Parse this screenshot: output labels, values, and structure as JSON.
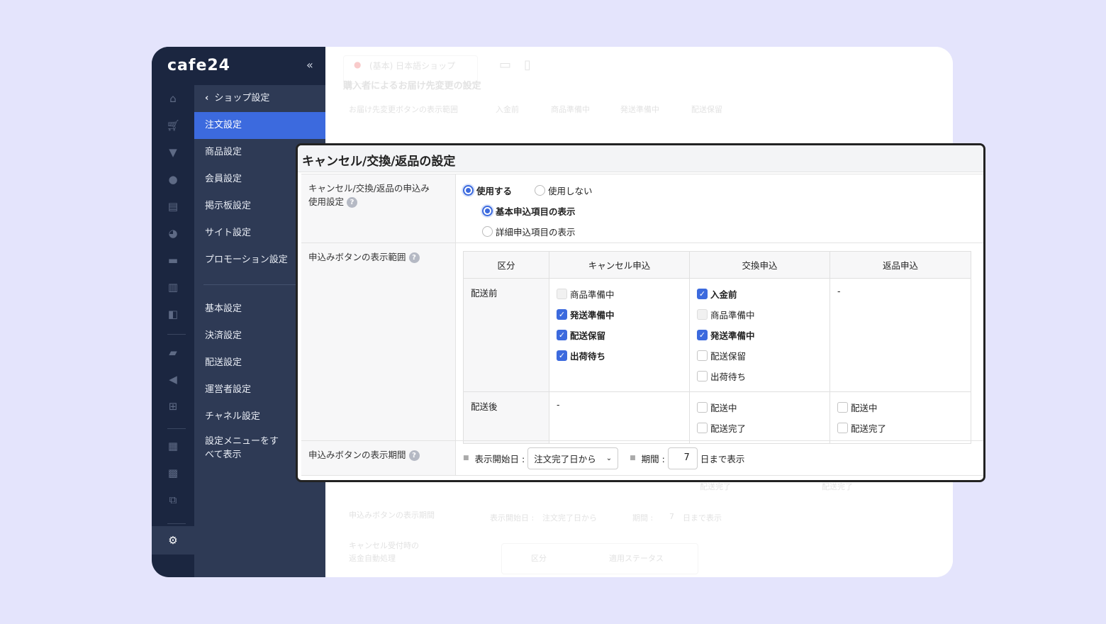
{
  "sidebar": {
    "logo": "cafe24",
    "collapse": "«",
    "back": "‹",
    "section": "ショップ設定",
    "items": [
      "注文設定",
      "商品設定",
      "会員設定",
      "掲示板設定",
      "サイト設定",
      "プロモーション設定"
    ],
    "items2": [
      "基本設定",
      "決済設定",
      "配送設定",
      "運営者設定",
      "チャネル設定"
    ],
    "show_all": "設定メニューをすべて表示"
  },
  "background": {
    "shop": "(基本) 日本語ショップ",
    "section": "購入者によるお届け先変更の設定",
    "range_label": "お届け先変更ボタンの表示範囲",
    "statuses": [
      "入金前",
      "商品準備中",
      "発送準備中",
      "配送保留"
    ],
    "done1": "配送完了",
    "done2": "配送完了",
    "period_label": "申込みボタンの表示期間",
    "start": "表示開始日 :",
    "start_val": "注文完了日から",
    "period": "期間 :",
    "days": "7",
    "until": "日まで表示",
    "refund_label1": "キャンセル受付時の",
    "refund_label2": "返金自動処理",
    "col1": "区分",
    "col2": "適用ステータス"
  },
  "panel": {
    "title": "キャンセル/交換/返品の設定",
    "use_label1": "キャンセル/交換/返品の申込み",
    "use_label2": "使用設定",
    "use_on": "使用する",
    "use_off": "使用しない",
    "basic": "基本申込項目の表示",
    "detail": "詳細申込項目の表示",
    "range_label": "申込みボタンの表示範囲",
    "headers": [
      "区分",
      "キャンセル申込",
      "交換申込",
      "返品申込"
    ],
    "before": "配送前",
    "after": "配送後",
    "cancel_before": [
      {
        "label": "商品準備中",
        "state": "disabled"
      },
      {
        "label": "発送準備中",
        "state": "checked"
      },
      {
        "label": "配送保留",
        "state": "checked"
      },
      {
        "label": "出荷待ち",
        "state": "checked"
      }
    ],
    "exchange_before": [
      {
        "label": "入金前",
        "state": "checked"
      },
      {
        "label": "商品準備中",
        "state": "disabled"
      },
      {
        "label": "発送準備中",
        "state": "checked"
      },
      {
        "label": "配送保留",
        "state": "unchecked"
      },
      {
        "label": "出荷待ち",
        "state": "unchecked"
      }
    ],
    "return_before": "-",
    "cancel_after": "-",
    "exchange_after": [
      "配送中",
      "配送完了"
    ],
    "return_after": [
      "配送中",
      "配送完了"
    ],
    "period_label": "申込みボタンの表示期間",
    "start": "表示開始日 :",
    "start_val": "注文完了日から",
    "period": "期間 :",
    "days": "7",
    "until": "日まで表示",
    "help": "?"
  }
}
